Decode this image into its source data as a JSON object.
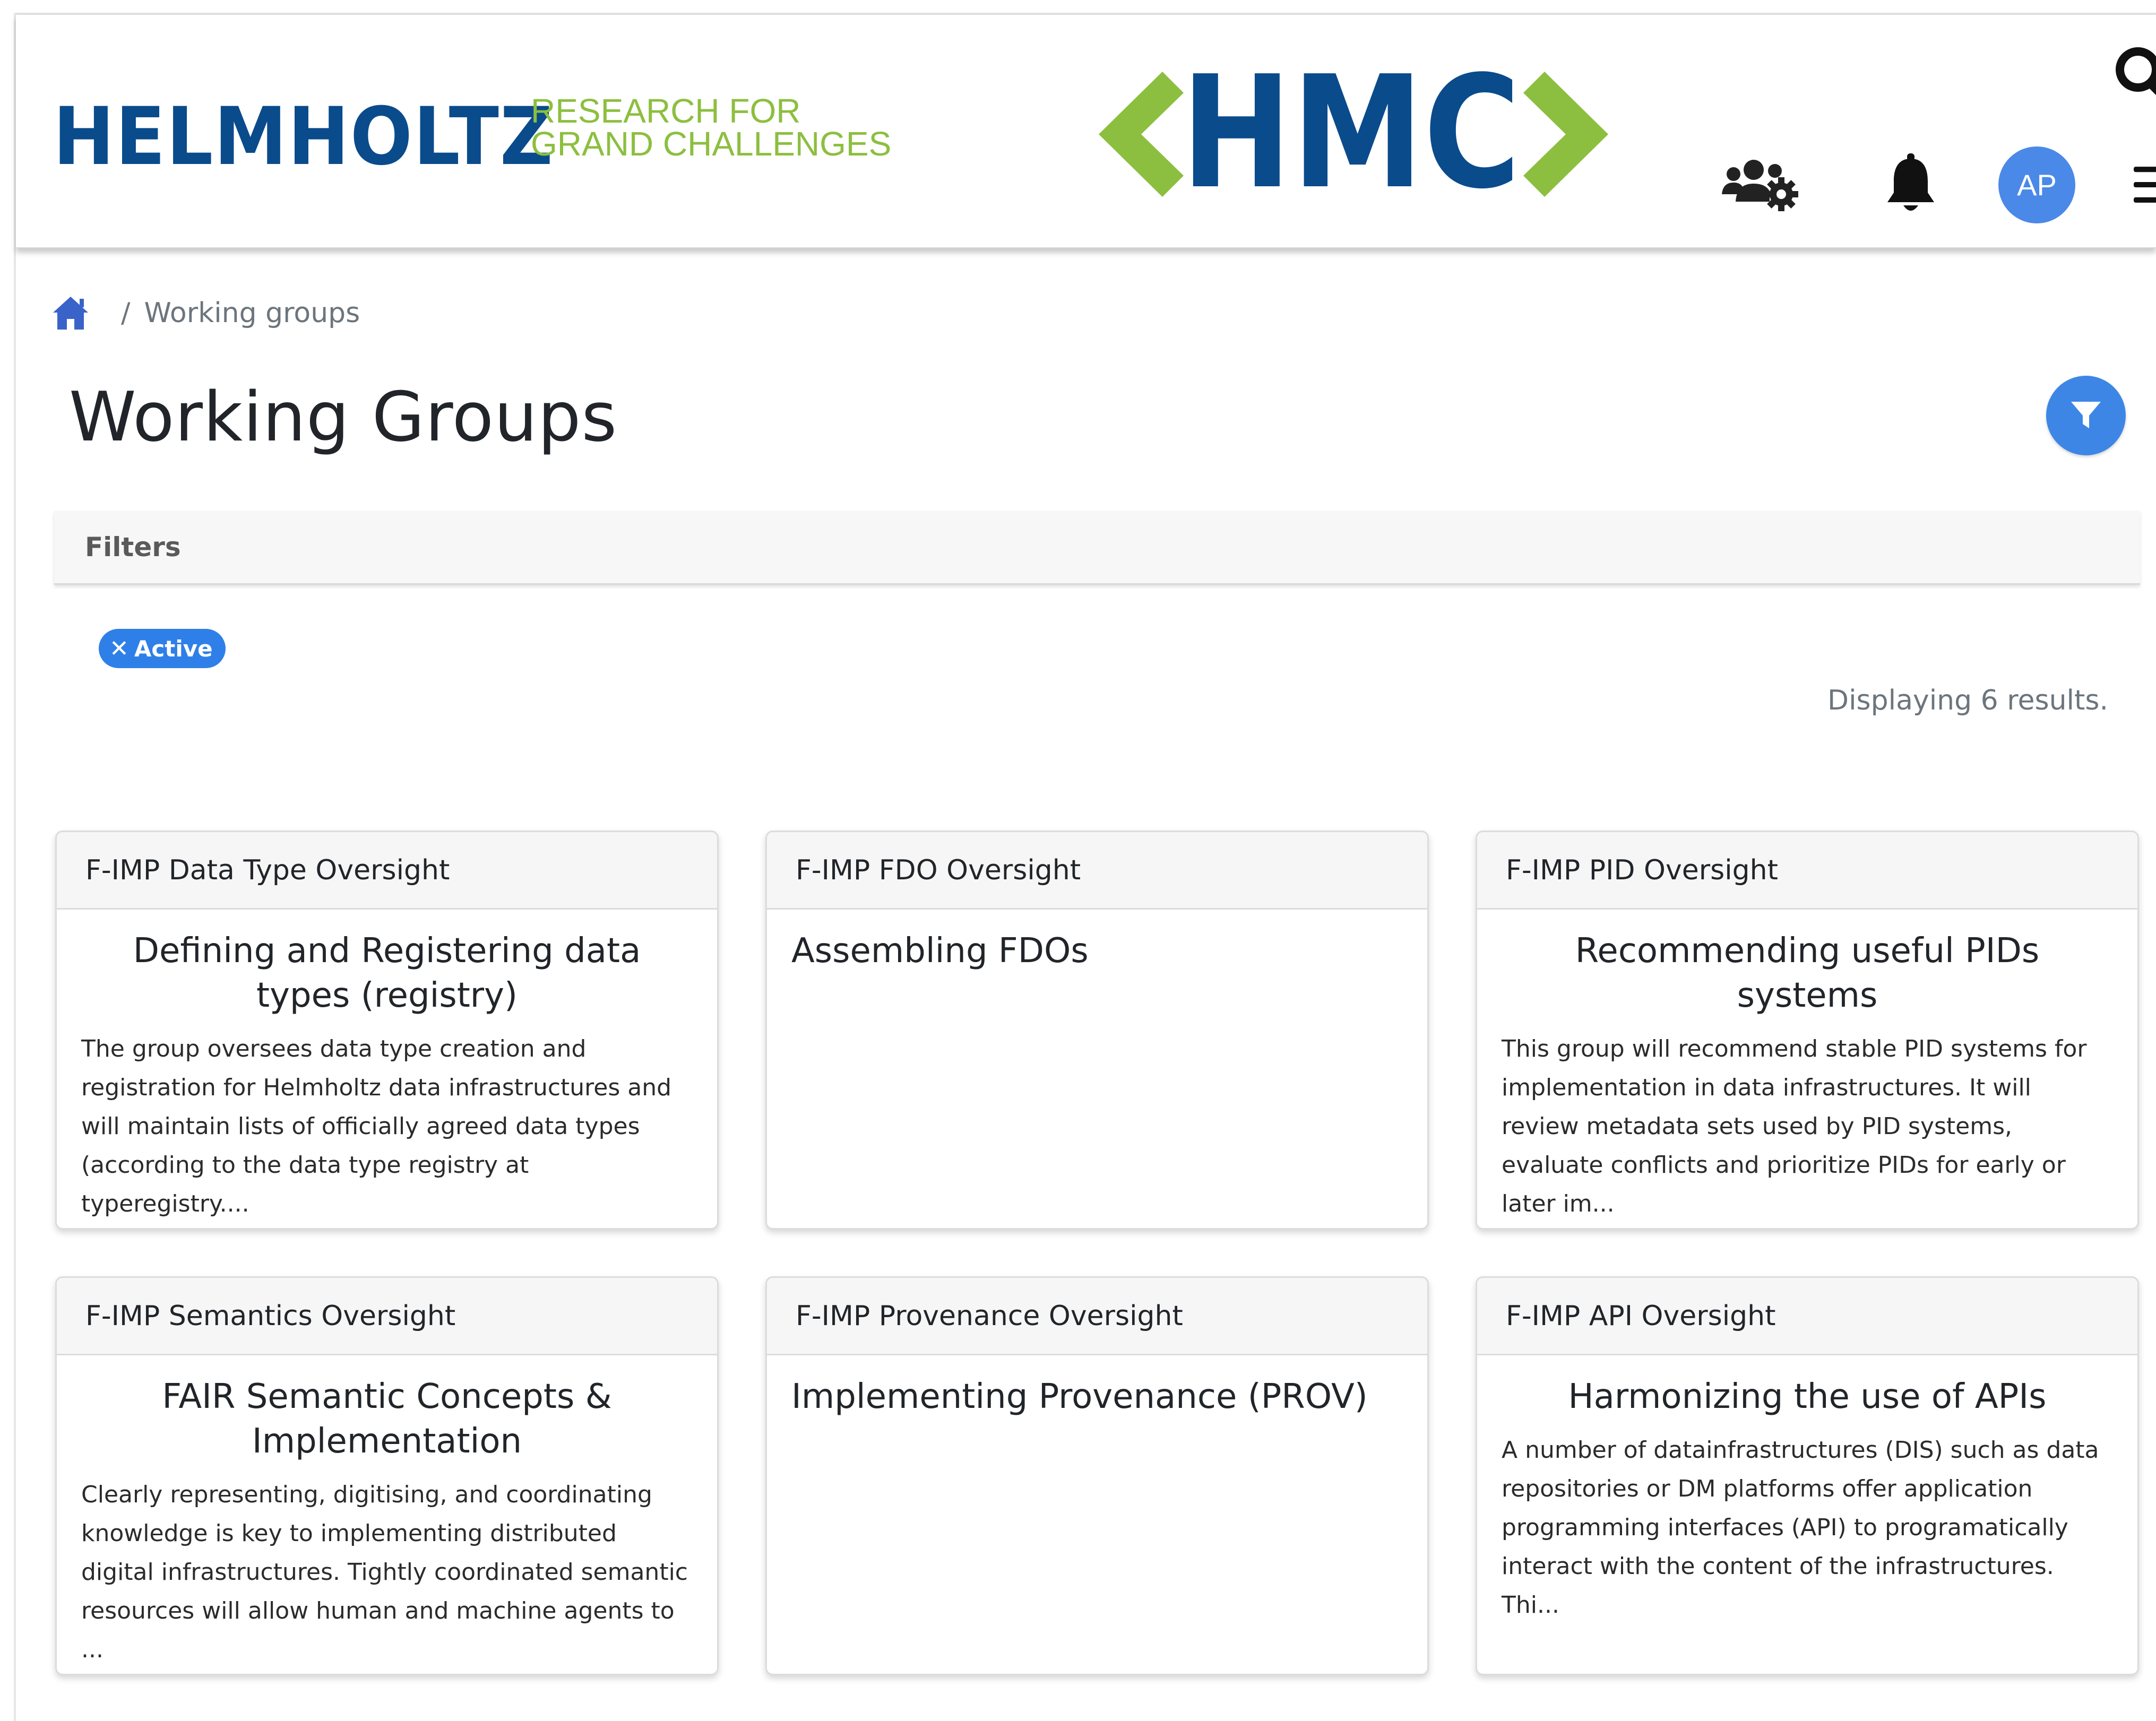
{
  "header": {
    "brand_name": "HELMHOLTZ",
    "brand_tag_line1": "RESEARCH FOR",
    "brand_tag_line2": "GRAND CHALLENGES",
    "logo_text": "HMC",
    "avatar_initials": "AP",
    "icons": [
      "search-icon",
      "user-group-settings-icon",
      "bell-icon",
      "menu-icon"
    ],
    "colors": {
      "brand_blue": "#0a4b8c",
      "brand_green": "#8cbf3f",
      "accent": "#3d86e6"
    }
  },
  "breadcrumb": {
    "home_icon": "home-icon",
    "separator": "/",
    "current": "Working groups"
  },
  "page": {
    "title": "Working Groups",
    "filter_button_icon": "filter-icon"
  },
  "filters": {
    "panel_label": "Filters",
    "active_chips": [
      {
        "icon": "close-icon",
        "label": "Active"
      }
    ],
    "results_text": "Displaying 6 results."
  },
  "cards": [
    {
      "header": "F-IMP Data Type Oversight",
      "title": "Defining and Registering data types (registry)",
      "description": "The group oversees data type creation and registration for Helmholtz data infrastructures and will maintain lists of officially agreed data types (according to the data type registry at typeregistry...."
    },
    {
      "header": "F-IMP FDO Oversight",
      "title": "Assembling FDOs",
      "description": ""
    },
    {
      "header": "F-IMP PID Oversight",
      "title": "Recommending useful PIDs systems",
      "description": "This group will recommend stable PID systems for implementation in data infrastructures. It will review metadata sets used by PID systems, evaluate conflicts and prioritize PIDs for early or later im..."
    },
    {
      "header": "F-IMP Semantics Oversight",
      "title": "FAIR Semantic Concepts & Implementation",
      "description": "Clearly representing, digitising, and coordinating knowledge is key to implementing distributed digital infrastructures. Tightly coordinated semantic resources will allow human and machine agents to ..."
    },
    {
      "header": "F-IMP Provenance Oversight",
      "title": "Implementing Provenance (PROV)",
      "description": ""
    },
    {
      "header": "F-IMP API Oversight",
      "title": "Harmonizing the use of APIs",
      "description": "A number of datainfrastructures (DIS) such as data repositories or DM platforms offer application programming interfaces (API) to programatically interact with the content of the infrastructures. Thi..."
    }
  ]
}
